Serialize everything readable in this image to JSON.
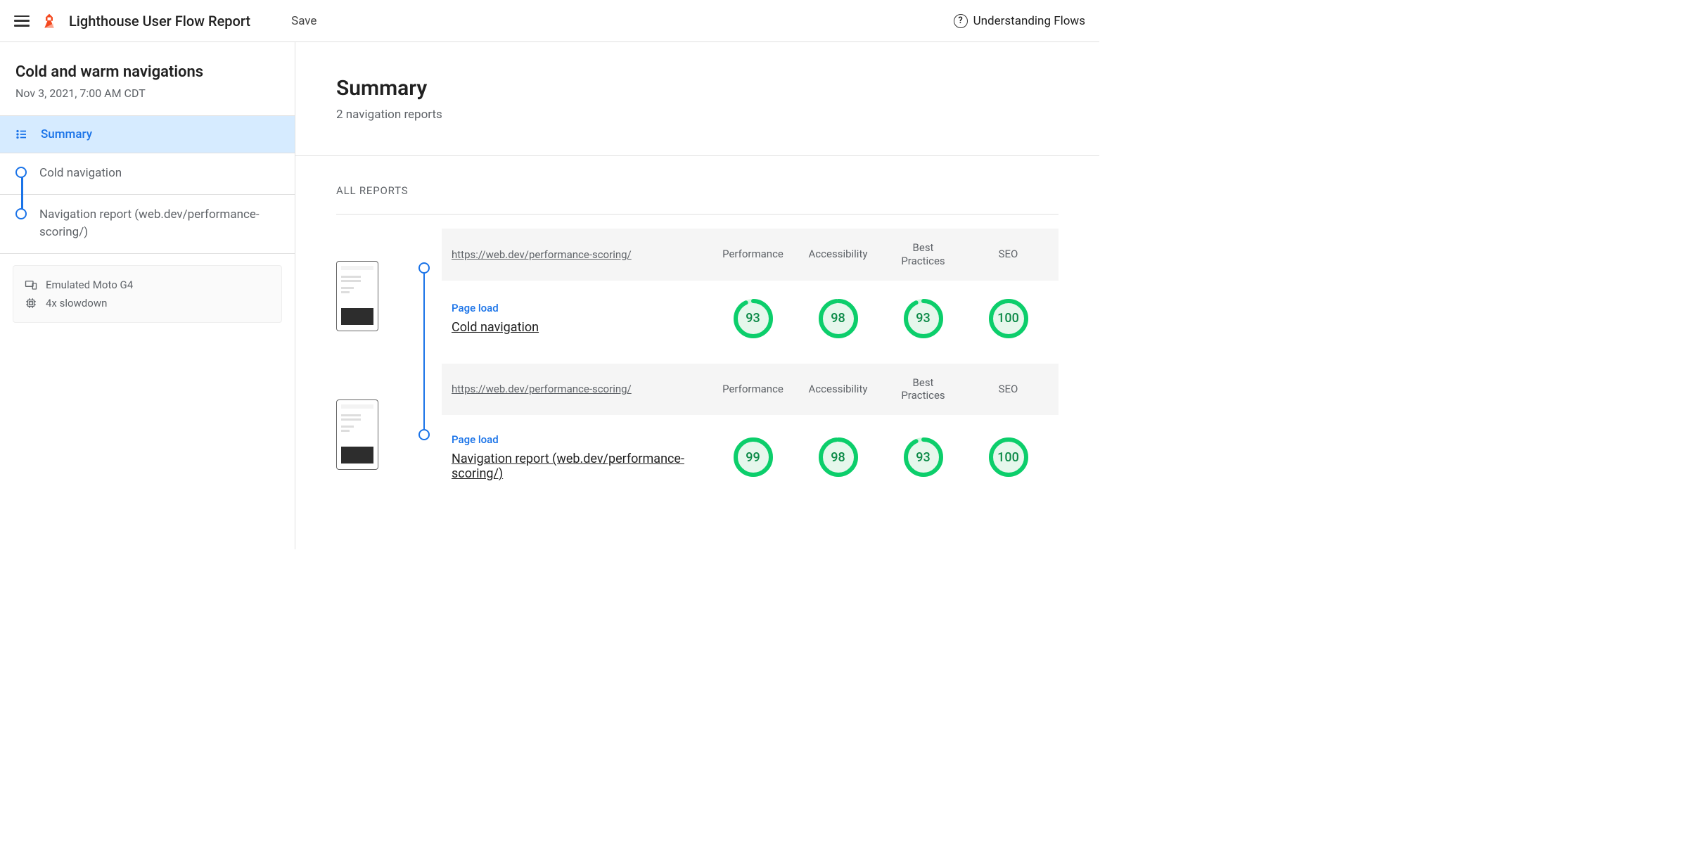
{
  "topbar": {
    "title": "Lighthouse User Flow Report",
    "save": "Save",
    "help": "Understanding Flows"
  },
  "sidebar": {
    "flowTitle": "Cold and warm navigations",
    "flowDate": "Nov 3, 2021, 7:00 AM CDT",
    "summaryLabel": "Summary",
    "steps": [
      {
        "label": "Cold navigation"
      },
      {
        "label": "Navigation report (web.dev/performance-scoring/)"
      }
    ],
    "device": "Emulated Moto G4",
    "throttle": "4x slowdown"
  },
  "main": {
    "summaryTitle": "Summary",
    "summarySubtitle": "2 navigation reports",
    "allReportsLabel": "ALL REPORTS",
    "columns": [
      "Performance",
      "Accessibility",
      "Best Practices",
      "SEO"
    ],
    "stepKind": "Page load",
    "reports": [
      {
        "url": "https://web.dev/performance-scoring/",
        "stepName": "Cold navigation",
        "scores": [
          93,
          98,
          93,
          100
        ]
      },
      {
        "url": "https://web.dev/performance-scoring/",
        "stepName": "Navigation report (web.dev/performance-scoring/)",
        "scores": [
          99,
          98,
          93,
          100
        ]
      }
    ]
  },
  "colors": {
    "pass": "#0cce6b",
    "passFill": "#e6f7ec",
    "link": "#1a73e8"
  }
}
